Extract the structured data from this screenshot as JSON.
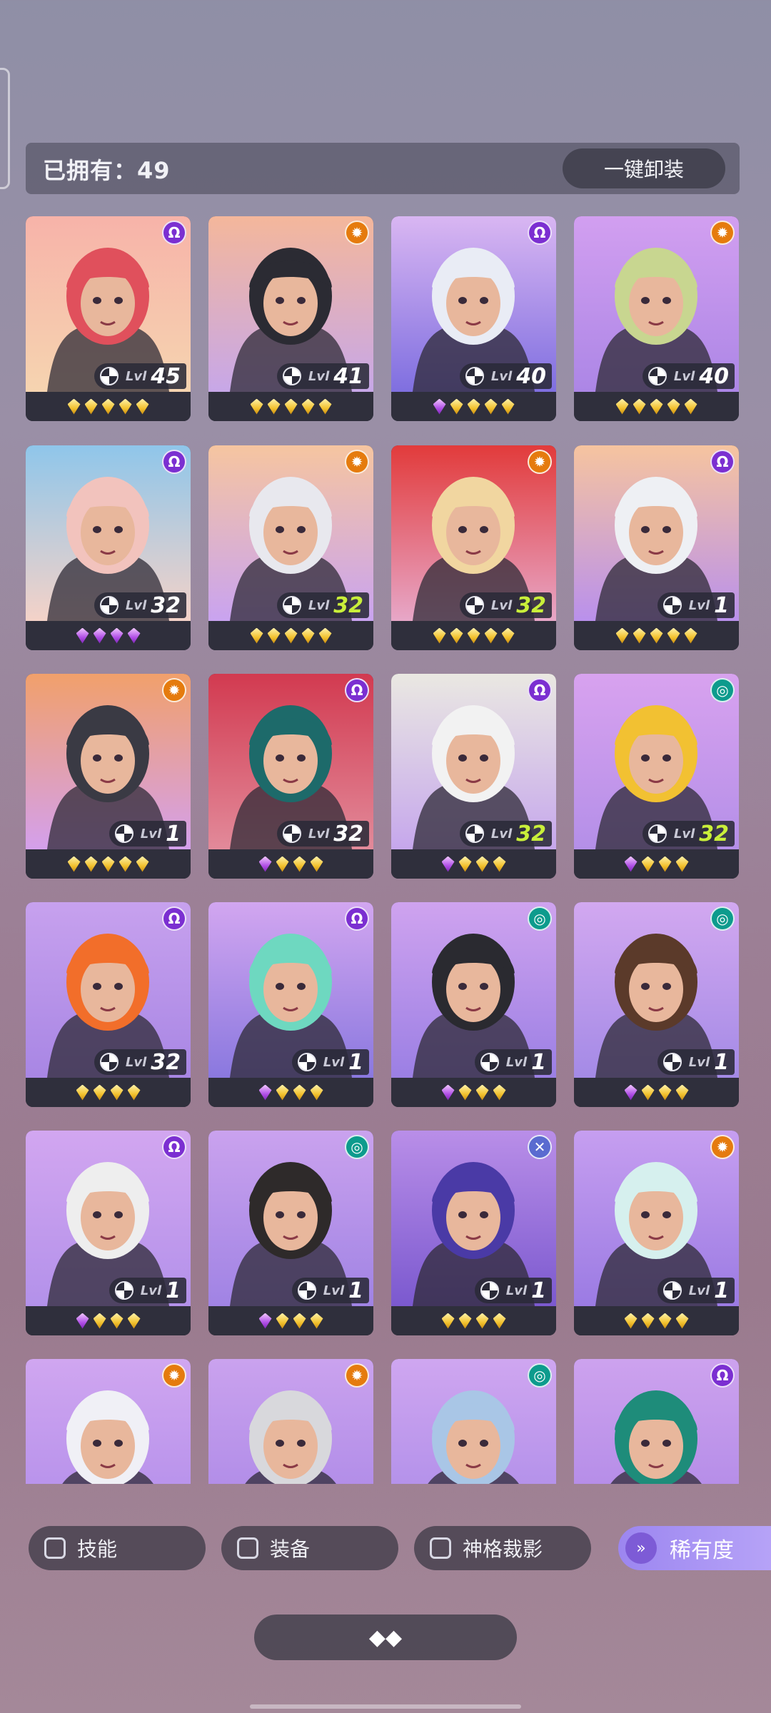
{
  "header": {
    "owned_label": "已拥有：49",
    "unequip_all": "一键卸装"
  },
  "cards": [
    {
      "level": "45",
      "green": false,
      "badge": "purple",
      "badge_icon": "Ω",
      "gems": [
        "gold",
        "gold",
        "gold",
        "gold",
        "gold"
      ],
      "bg": [
        "#f7b3a9",
        "#f6d4b0"
      ],
      "hair": "#e0505c"
    },
    {
      "level": "41",
      "green": false,
      "badge": "orange",
      "badge_icon": "✹",
      "gems": [
        "gold",
        "gold",
        "gold",
        "gold",
        "gold"
      ],
      "bg": [
        "#f4b79b",
        "#c7a7e8"
      ],
      "hair": "#2b2b33"
    },
    {
      "level": "40",
      "green": false,
      "badge": "purple",
      "badge_icon": "Ω",
      "gems": [
        "purple",
        "gold",
        "gold",
        "gold",
        "gold"
      ],
      "bg": [
        "#d9b6f2",
        "#7f6fe0"
      ],
      "hair": "#e9ecf5"
    },
    {
      "level": "40",
      "green": false,
      "badge": "orange",
      "badge_icon": "✹",
      "gems": [
        "gold",
        "gold",
        "gold",
        "gold",
        "gold"
      ],
      "bg": [
        "#d29ff0",
        "#ac86e6"
      ],
      "hair": "#c8d690"
    },
    {
      "level": "32",
      "green": false,
      "badge": "purple",
      "badge_icon": "Ω",
      "gems": [
        "purple",
        "purple",
        "purple",
        "purple"
      ],
      "bg": [
        "#8fc6ea",
        "#f4d2c8"
      ],
      "hair": "#f2c3bd"
    },
    {
      "level": "32",
      "green": true,
      "badge": "orange",
      "badge_icon": "✹",
      "gems": [
        "gold",
        "gold",
        "gold",
        "gold",
        "gold"
      ],
      "bg": [
        "#f6c5a0",
        "#c9a3f0"
      ],
      "hair": "#e8e8ee"
    },
    {
      "level": "32",
      "green": true,
      "badge": "orange",
      "badge_icon": "✹",
      "gems": [
        "gold",
        "gold",
        "gold",
        "gold",
        "gold"
      ],
      "bg": [
        "#e23b3b",
        "#e7a7c8"
      ],
      "hair": "#f1d6a0"
    },
    {
      "level": "1",
      "green": false,
      "badge": "purple",
      "badge_icon": "Ω",
      "gems": [
        "gold",
        "gold",
        "gold",
        "gold",
        "gold"
      ],
      "bg": [
        "#f6c49f",
        "#b990ec"
      ],
      "hair": "#eef0f4"
    },
    {
      "level": "1",
      "green": false,
      "badge": "orange",
      "badge_icon": "✹",
      "gems": [
        "gold",
        "gold",
        "gold",
        "gold",
        "gold"
      ],
      "bg": [
        "#f1a06b",
        "#d4a0ec"
      ],
      "hair": "#3a3a44"
    },
    {
      "level": "32",
      "green": false,
      "badge": "purple",
      "badge_icon": "Ω",
      "gems": [
        "purple",
        "gold",
        "gold",
        "gold"
      ],
      "bg": [
        "#d23a50",
        "#e28a9a"
      ],
      "hair": "#1d6a6a"
    },
    {
      "level": "32",
      "green": true,
      "badge": "purple",
      "badge_icon": "Ω",
      "gems": [
        "purple",
        "gold",
        "gold",
        "gold"
      ],
      "bg": [
        "#eae8e2",
        "#c6a7ec"
      ],
      "hair": "#f2f2f2"
    },
    {
      "level": "32",
      "green": true,
      "badge": "teal",
      "badge_icon": "◎",
      "gems": [
        "purple",
        "gold",
        "gold",
        "gold"
      ],
      "bg": [
        "#d8a2ef",
        "#b48fe8"
      ],
      "hair": "#f2c132"
    },
    {
      "level": "32",
      "green": false,
      "badge": "purple",
      "badge_icon": "Ω",
      "gems": [
        "gold",
        "gold",
        "gold",
        "gold"
      ],
      "bg": [
        "#c7a1ee",
        "#a886e4"
      ],
      "hair": "#f26e2a"
    },
    {
      "level": "1",
      "green": false,
      "badge": "purple",
      "badge_icon": "Ω",
      "gems": [
        "purple",
        "gold",
        "gold",
        "gold"
      ],
      "bg": [
        "#d2a6f0",
        "#8a78df"
      ],
      "hair": "#6ed8c0"
    },
    {
      "level": "1",
      "green": false,
      "badge": "teal",
      "badge_icon": "◎",
      "gems": [
        "purple",
        "gold",
        "gold",
        "gold"
      ],
      "bg": [
        "#cfa3ef",
        "#9b7fe4"
      ],
      "hair": "#2a2a30"
    },
    {
      "level": "1",
      "green": false,
      "badge": "teal",
      "badge_icon": "◎",
      "gems": [
        "purple",
        "gold",
        "gold",
        "gold"
      ],
      "bg": [
        "#d2a8f0",
        "#a48ae6"
      ],
      "hair": "#5b3a2a"
    },
    {
      "level": "1",
      "green": false,
      "badge": "purple",
      "badge_icon": "Ω",
      "gems": [
        "purple",
        "gold",
        "gold",
        "gold"
      ],
      "bg": [
        "#d2a6f0",
        "#b391ea"
      ],
      "hair": "#eeeeee"
    },
    {
      "level": "1",
      "green": false,
      "badge": "teal",
      "badge_icon": "◎",
      "gems": [
        "purple",
        "gold",
        "gold",
        "gold"
      ],
      "bg": [
        "#caa2ee",
        "#a083e4"
      ],
      "hair": "#2e2a2a"
    },
    {
      "level": "1",
      "green": false,
      "badge": "blue",
      "badge_icon": "✕",
      "gems": [
        "gold",
        "gold",
        "gold",
        "gold"
      ],
      "bg": [
        "#b98ee8",
        "#7b59cf"
      ],
      "hair": "#4a3aa6"
    },
    {
      "level": "1",
      "green": false,
      "badge": "orange",
      "badge_icon": "✹",
      "gems": [
        "gold",
        "gold",
        "gold",
        "gold"
      ],
      "bg": [
        "#c69ef0",
        "#9b7be3"
      ],
      "hair": "#d6f0ee"
    },
    {
      "level": "",
      "green": false,
      "badge": "orange",
      "badge_icon": "✹",
      "gems": [],
      "bg": [
        "#d0a6f0",
        "#b08cea"
      ],
      "hair": "#f0f0f6"
    },
    {
      "level": "",
      "green": false,
      "badge": "orange",
      "badge_icon": "✹",
      "gems": [],
      "bg": [
        "#caa2ee",
        "#a986e6"
      ],
      "hair": "#d8d8dc"
    },
    {
      "level": "",
      "green": false,
      "badge": "teal",
      "badge_icon": "◎",
      "gems": [],
      "bg": [
        "#cfa6f0",
        "#aa8ae8"
      ],
      "hair": "#a9c6e6"
    },
    {
      "level": "",
      "green": false,
      "badge": "purple",
      "badge_icon": "Ω",
      "gems": [],
      "bg": [
        "#cda2ee",
        "#ad86e6"
      ],
      "hair": "#1e8c7a"
    }
  ],
  "lvl_label": "Lvl",
  "filters": {
    "skill": "技能",
    "gear": "装备",
    "divine": "神格裁影",
    "rarity": "稀有度"
  },
  "rarity_icon": "»",
  "bottom_pill_icon": "◆◆"
}
